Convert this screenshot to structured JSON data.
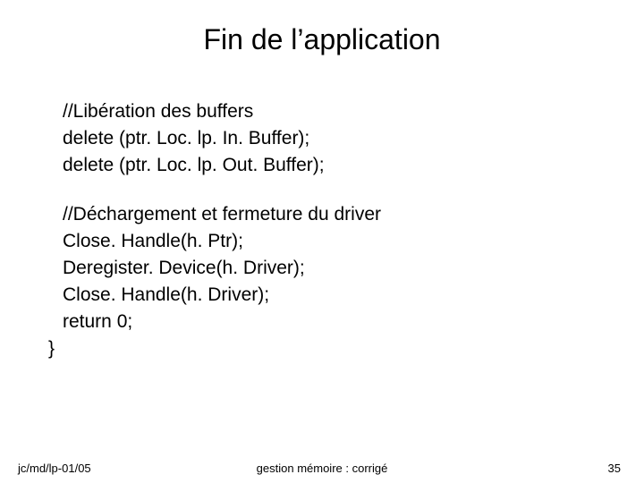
{
  "title": "Fin de l’application",
  "block1": {
    "comment": "//Libération des buffers",
    "lines": [
      "delete (ptr. Loc. lp. In. Buffer);",
      "delete (ptr. Loc. lp. Out. Buffer);"
    ]
  },
  "block2": {
    "comment": "//Déchargement et fermeture du driver",
    "lines": [
      "Close. Handle(h. Ptr);",
      "Deregister. Device(h. Driver);",
      "Close. Handle(h. Driver);",
      "return 0;"
    ]
  },
  "closing_brace": "}",
  "footer": {
    "left": "jc/md/lp-01/05",
    "center": "gestion mémoire : corrigé",
    "right": "35"
  }
}
